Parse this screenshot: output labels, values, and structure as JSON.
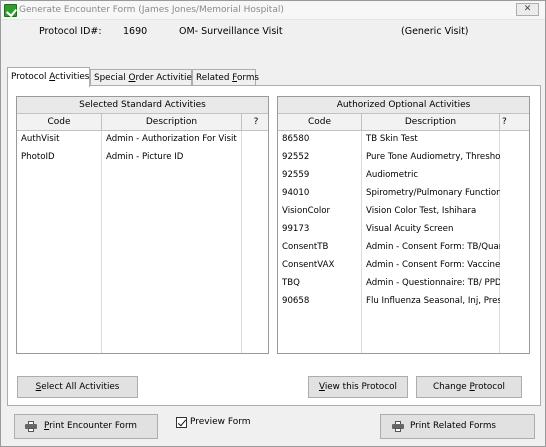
{
  "window": {
    "title": "Generate Encounter Form (James Jones/Memorial Hospital)",
    "close_label": "✕"
  },
  "header": {
    "protocol_label": "Protocol ID#:",
    "protocol_id": "1690",
    "protocol_name": "OM- Surveillance Visit",
    "visit_type": "(Generic Visit)"
  },
  "tabs": [
    {
      "pre": "Protocol ",
      "key": "A",
      "post": "ctivities"
    },
    {
      "pre": "Special ",
      "key": "O",
      "post": "rder Activities"
    },
    {
      "pre": "Related ",
      "key": "F",
      "post": "orms"
    }
  ],
  "standard": {
    "caption": "Selected Standard Activities",
    "columns": [
      "Code",
      "Description",
      "?"
    ],
    "rows": [
      {
        "code": "AuthVisit",
        "description": "Admin - Authorization For Visit"
      },
      {
        "code": "PhotoID",
        "description": "Admin - Picture ID"
      }
    ]
  },
  "optional": {
    "caption": "Authorized Optional Activities",
    "columns": [
      "Code",
      "Description",
      "?"
    ],
    "rows": [
      {
        "code": "86580",
        "description": "TB Skin Test"
      },
      {
        "code": "92552",
        "description": "Pure Tone Audiometry, Thresholc"
      },
      {
        "code": "92559",
        "description": "Audiometric"
      },
      {
        "code": "94010",
        "description": "Spirometry/Pulmonary Function"
      },
      {
        "code": "VisionColor",
        "description": "Vision Color Test, Ishihara"
      },
      {
        "code": "99173",
        "description": "Visual Acuity Screen"
      },
      {
        "code": "ConsentTB",
        "description": "Admin - Consent Form: TB/Quan"
      },
      {
        "code": "ConsentVAX",
        "description": "Admin - Consent Form: Vaccines"
      },
      {
        "code": "TBQ",
        "description": "Admin - Questionnaire: TB/ PPD"
      },
      {
        "code": "90658",
        "description": "Flu Influenza Seasonal, Inj, Preser"
      }
    ]
  },
  "buttons": {
    "select_all": {
      "key": "S",
      "rest": "elect All Activities"
    },
    "view_protocol": {
      "key": "V",
      "rest": "iew this Protocol"
    },
    "change_protocol": {
      "pre": "Change ",
      "key": "P",
      "rest": "rotocol"
    },
    "print_encounter": {
      "key": "P",
      "rest": "rint Encounter Form"
    },
    "print_related": {
      "label": "Print Related Forms"
    }
  },
  "preview_form": {
    "label": "Preview Form",
    "checked": true
  }
}
